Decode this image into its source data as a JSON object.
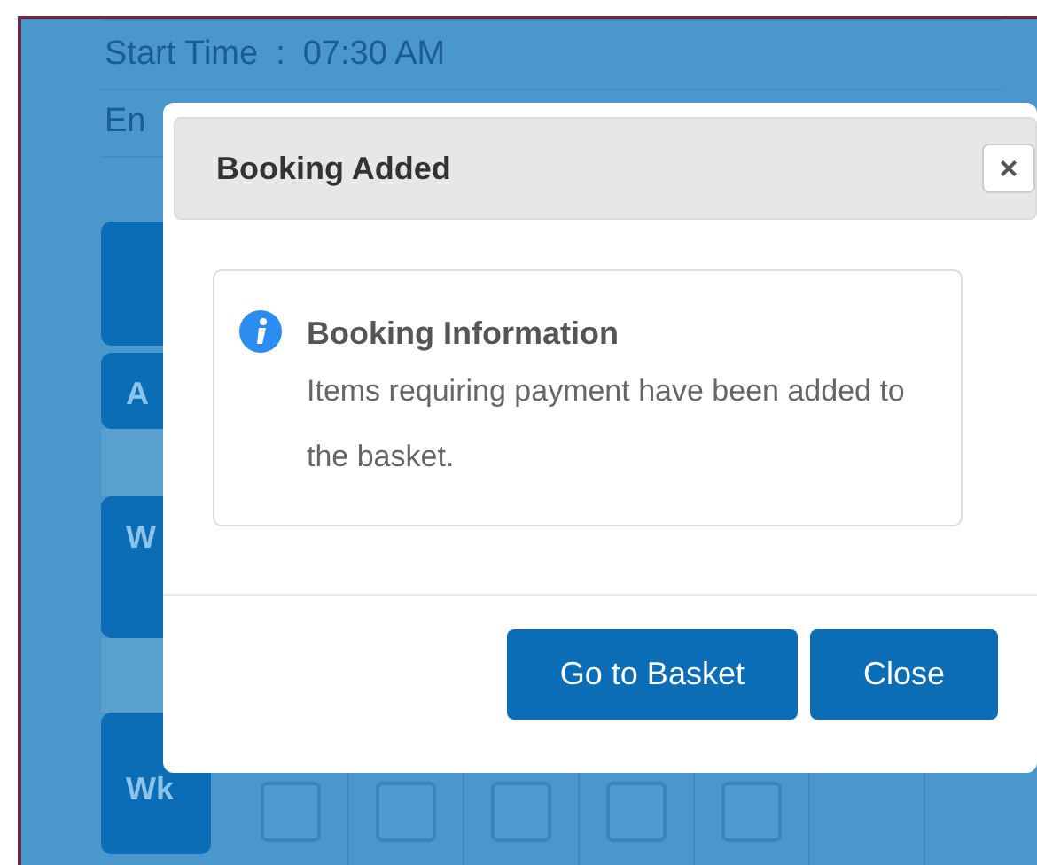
{
  "page": {
    "fields": [
      {
        "label": "Start Time",
        "separator": ":",
        "value": "07:30 AM"
      },
      {
        "label": "En"
      }
    ],
    "side_tabs": [
      {
        "kind": "blank"
      },
      {
        "kind": "label",
        "label": "A"
      },
      {
        "kind": "label",
        "label": "W"
      },
      {
        "kind": "label",
        "label": "Wk"
      }
    ],
    "checkboxes": [
      {
        "checked": false
      },
      {
        "checked": false
      },
      {
        "checked": false
      },
      {
        "checked": false
      },
      {
        "checked": false
      }
    ]
  },
  "dialog": {
    "title": "Booking Added",
    "close": "×",
    "info": {
      "title": "Booking Information",
      "message": "Items requiring payment have been added to the basket."
    },
    "buttons": [
      "Go to Basket",
      "Close"
    ]
  }
}
